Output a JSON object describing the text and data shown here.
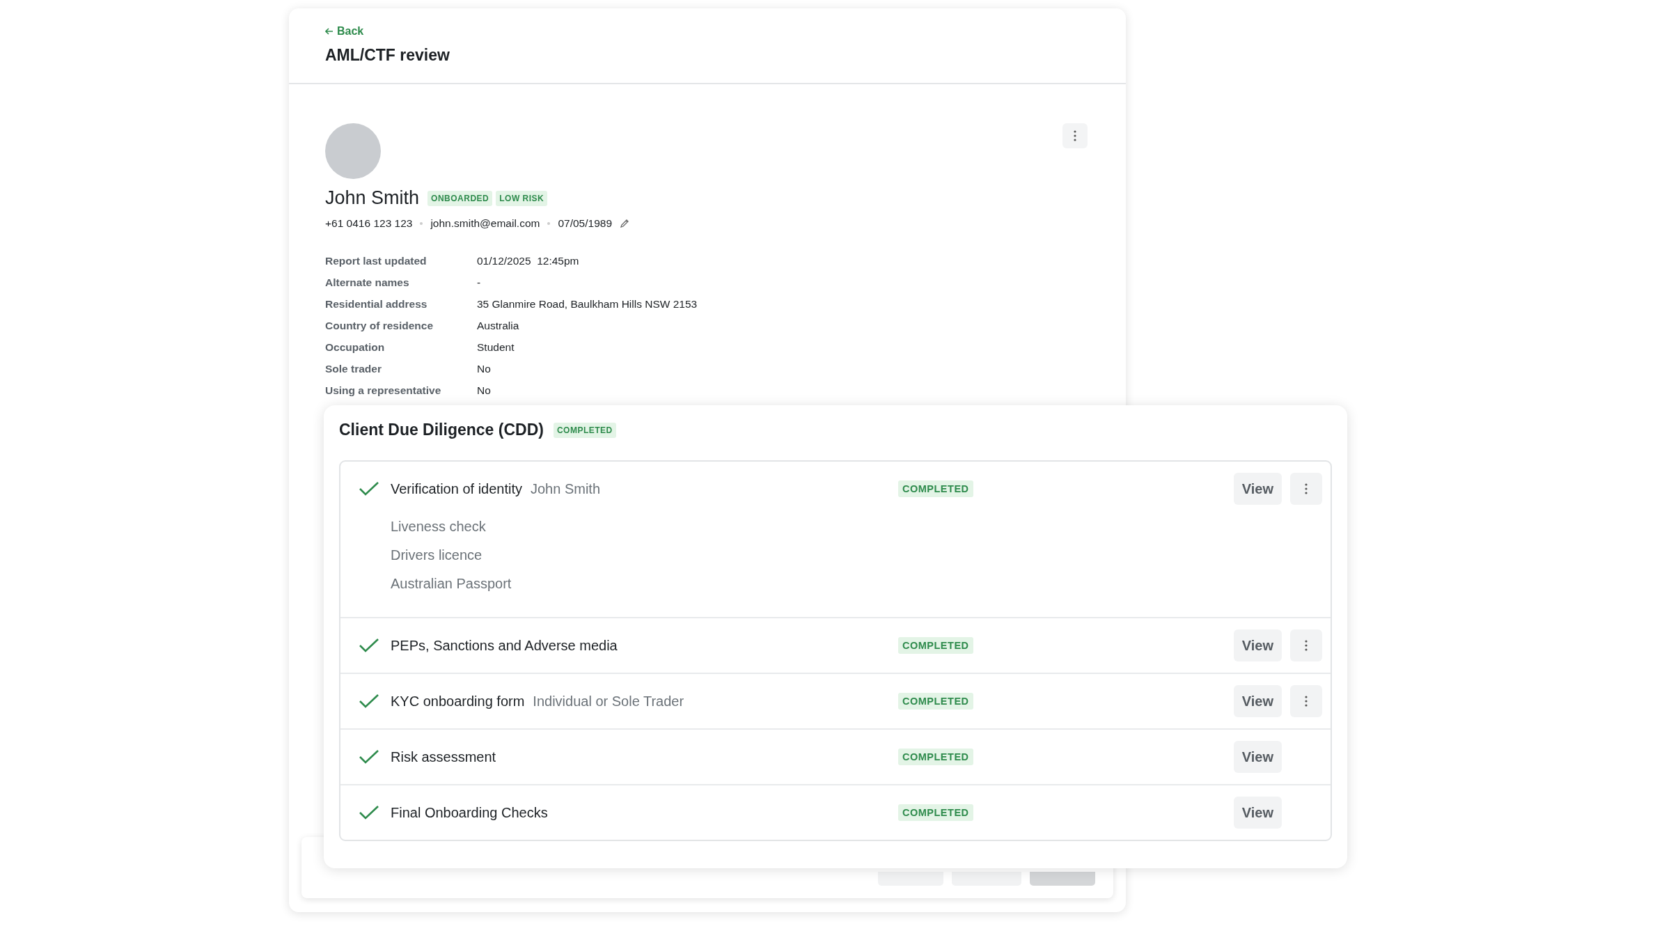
{
  "header": {
    "back": "Back",
    "title": "AML/CTF review"
  },
  "profile": {
    "name": "John Smith",
    "badges": [
      "ONBOARDED",
      "LOW RISK"
    ],
    "contacts": [
      "+61 0416 123 123",
      "john.smith@email.com",
      "07/05/1989"
    ],
    "details": [
      {
        "label": "Report last updated",
        "value": "01/12/2025  12:45pm"
      },
      {
        "label": "Alternate names",
        "value": "-"
      },
      {
        "label": "Residential address",
        "value": "35 Glanmire Road, Baulkham Hills NSW 2153"
      },
      {
        "label": "Country of residence",
        "value": "Australia"
      },
      {
        "label": "Occupation",
        "value": "Student"
      },
      {
        "label": "Sole trader",
        "value": "No"
      },
      {
        "label": "Using a representative",
        "value": "No"
      }
    ]
  },
  "cdd": {
    "title": "Client Due Diligence (CDD)",
    "status": "COMPLETED",
    "items": [
      {
        "title": "Verification of identity",
        "subtitle": "John Smith",
        "checked": true,
        "status": "COMPLETED",
        "subitems": [
          "Liveness check",
          "Drivers licence",
          "Australian Passport"
        ],
        "button": "View",
        "menu": true
      },
      {
        "title": "PEPs, Sanctions and Adverse media",
        "checked": true,
        "status": "COMPLETED",
        "button": "View",
        "menu": true
      },
      {
        "title": "KYC onboarding form",
        "subtitle": "Individual or Sole Trader",
        "checked": true,
        "status": "COMPLETED",
        "button": "View",
        "menu": true
      },
      {
        "title": "Risk assessment",
        "checked": true,
        "status": "COMPLETED",
        "button": "View",
        "menu": false
      },
      {
        "title": "Final Onboarding Checks",
        "checked": true,
        "status": "COMPLETED",
        "button": "View",
        "menu": false
      }
    ]
  },
  "footer": {
    "buttons": [
      {
        "disabled": false
      },
      {
        "disabled": false
      },
      {
        "disabled": true
      }
    ]
  }
}
